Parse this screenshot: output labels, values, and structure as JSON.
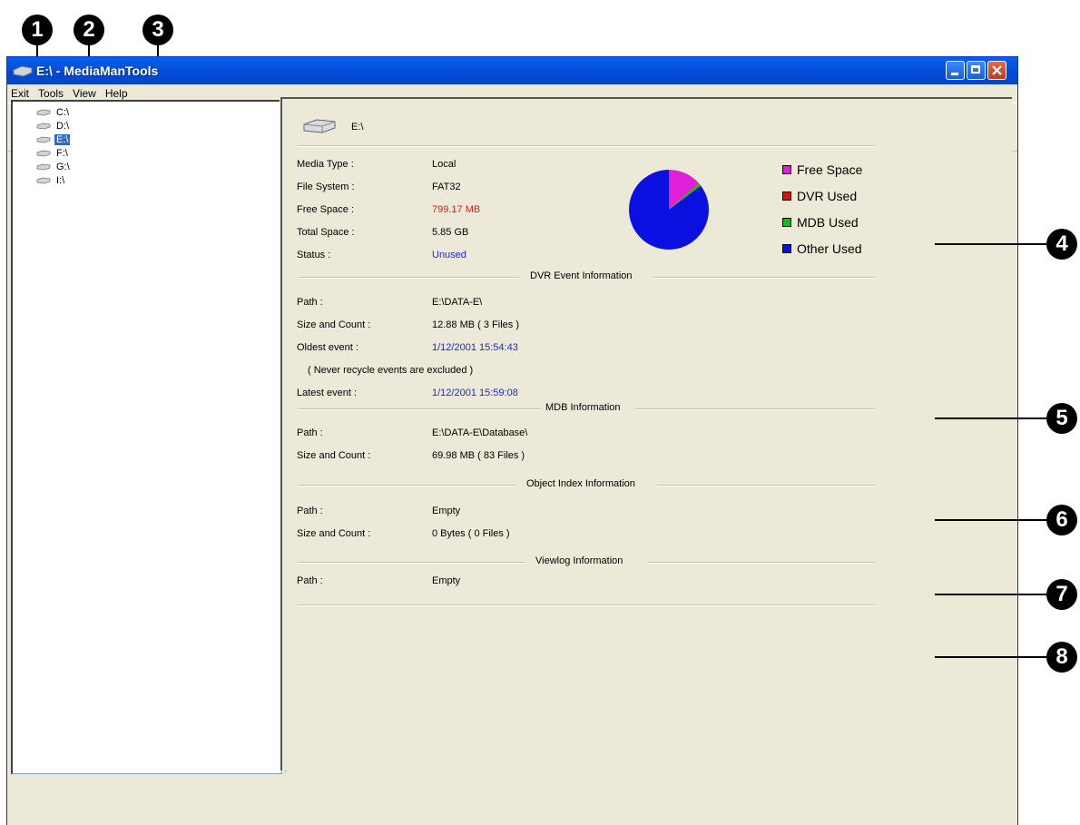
{
  "callouts": [
    "1",
    "2",
    "3",
    "4",
    "5",
    "6",
    "7",
    "8"
  ],
  "window": {
    "title": "E:\\ - MediaManTools",
    "menu": [
      "Exit",
      "Tools",
      "View",
      "Help"
    ]
  },
  "tree": {
    "items": [
      {
        "label": "C:\\"
      },
      {
        "label": "D:\\"
      },
      {
        "label": "E:\\",
        "selected": true
      },
      {
        "label": "F:\\"
      },
      {
        "label": "G:\\"
      },
      {
        "label": "I:\\"
      }
    ]
  },
  "drive": {
    "name": "E:\\",
    "media_type_label": "Media Type :",
    "media_type": "Local",
    "file_system_label": "File System :",
    "file_system": "FAT32",
    "free_space_label": "Free Space :",
    "free_space": "799.17 MB",
    "total_space_label": "Total Space :",
    "total_space": "5.85 GB",
    "status_label": "Status :",
    "status": "Unused"
  },
  "chart_data": {
    "type": "pie",
    "categories": [
      "Free Space",
      "DVR Used",
      "MDB Used",
      "Other Used"
    ],
    "values": [
      13.3,
      0.2,
      1.2,
      85.3
    ],
    "colors": [
      "#e020d8",
      "#e01010",
      "#10c010",
      "#0a10e0"
    ],
    "legend": "right"
  },
  "dvr": {
    "title": "DVR Event Information",
    "path_label": "Path :",
    "path": "E:\\DATA-E\\",
    "size_label": "Size and Count :",
    "size": "12.88 MB ( 3 Files )",
    "oldest_label": "Oldest event :",
    "oldest": "1/12/2001 15:54:43",
    "note": "( Never recycle events are excluded )",
    "latest_label": "Latest event :",
    "latest": "1/12/2001 15:59:08"
  },
  "mdb": {
    "title": "MDB Information",
    "path_label": "Path :",
    "path": "E:\\DATA-E\\Database\\",
    "size_label": "Size and Count :",
    "size": "69.98 MB ( 83 Files )"
  },
  "object_index": {
    "title": "Object Index Information",
    "path_label": "Path :",
    "path": "Empty",
    "size_label": "Size and Count :",
    "size": "0 Bytes ( 0 Files )"
  },
  "viewlog": {
    "title": "Viewlog Information",
    "path_label": "Path :",
    "path": "Empty"
  }
}
